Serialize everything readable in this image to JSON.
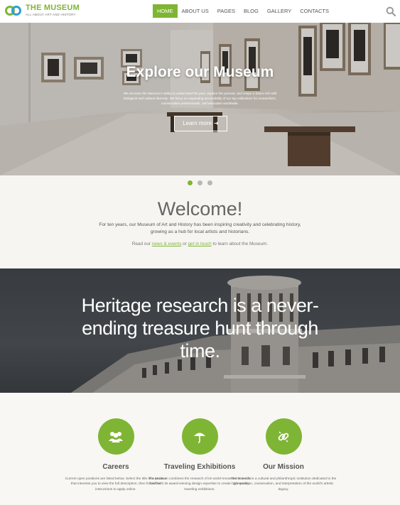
{
  "brand": {
    "title": "THE MUSEUM",
    "subtitle": "ALL ABOUT ART AND HISTORY"
  },
  "nav": {
    "items": [
      "HOME",
      "ABOUT US",
      "PAGES",
      "BLOG",
      "GALLERY",
      "CONTACTS"
    ],
    "active_index": 0
  },
  "hero": {
    "title": "Explore our Museum",
    "description": "We increase the Museum's ability to understand the past, explore the present, and shape a future rich with biological and cultural diversity. We focus on expanding accessibility of our top collections for researchers, conservation professionals, and education worldwide.",
    "button_label": "Learn more",
    "button_icon": "arrow-right-icon",
    "slides": 3,
    "active_slide": 0
  },
  "welcome": {
    "title": "Welcome!",
    "text": "For ten years, our Museum of Art and History has been inspiring creativity and celebrating history, growing as a hub for local artists and historians.",
    "links_prefix": "Read our ",
    "link1": "news & events",
    "links_middle": " or ",
    "link2": "get in touch",
    "links_suffix": " to learn about the Museum."
  },
  "banner": {
    "quote": "Heritage research is a never-ending treasure hunt through time."
  },
  "features": [
    {
      "icon": "people-icon",
      "title": "Careers",
      "text": "Current open positions are listed below. Select the title of a position that interests you to view the full description, then follow the instructions to apply online."
    },
    {
      "icon": "umbrella-icon",
      "title": "Traveling Exhibitions",
      "text": "The Museum combines the research of its world-renowned scientific staff with its award-winning design expertise to create high-quality traveling exhibitions."
    },
    {
      "icon": "link-icon",
      "title": "Our Mission",
      "text": "The Museum is a cultural and philanthropic institution dedicated to the presentation, conservation, and interpretation of the world's artistic legacy."
    }
  ],
  "colors": {
    "accent": "#7fb534",
    "accent_secondary": "#2e9fcf",
    "background": "#f6f5f2"
  }
}
